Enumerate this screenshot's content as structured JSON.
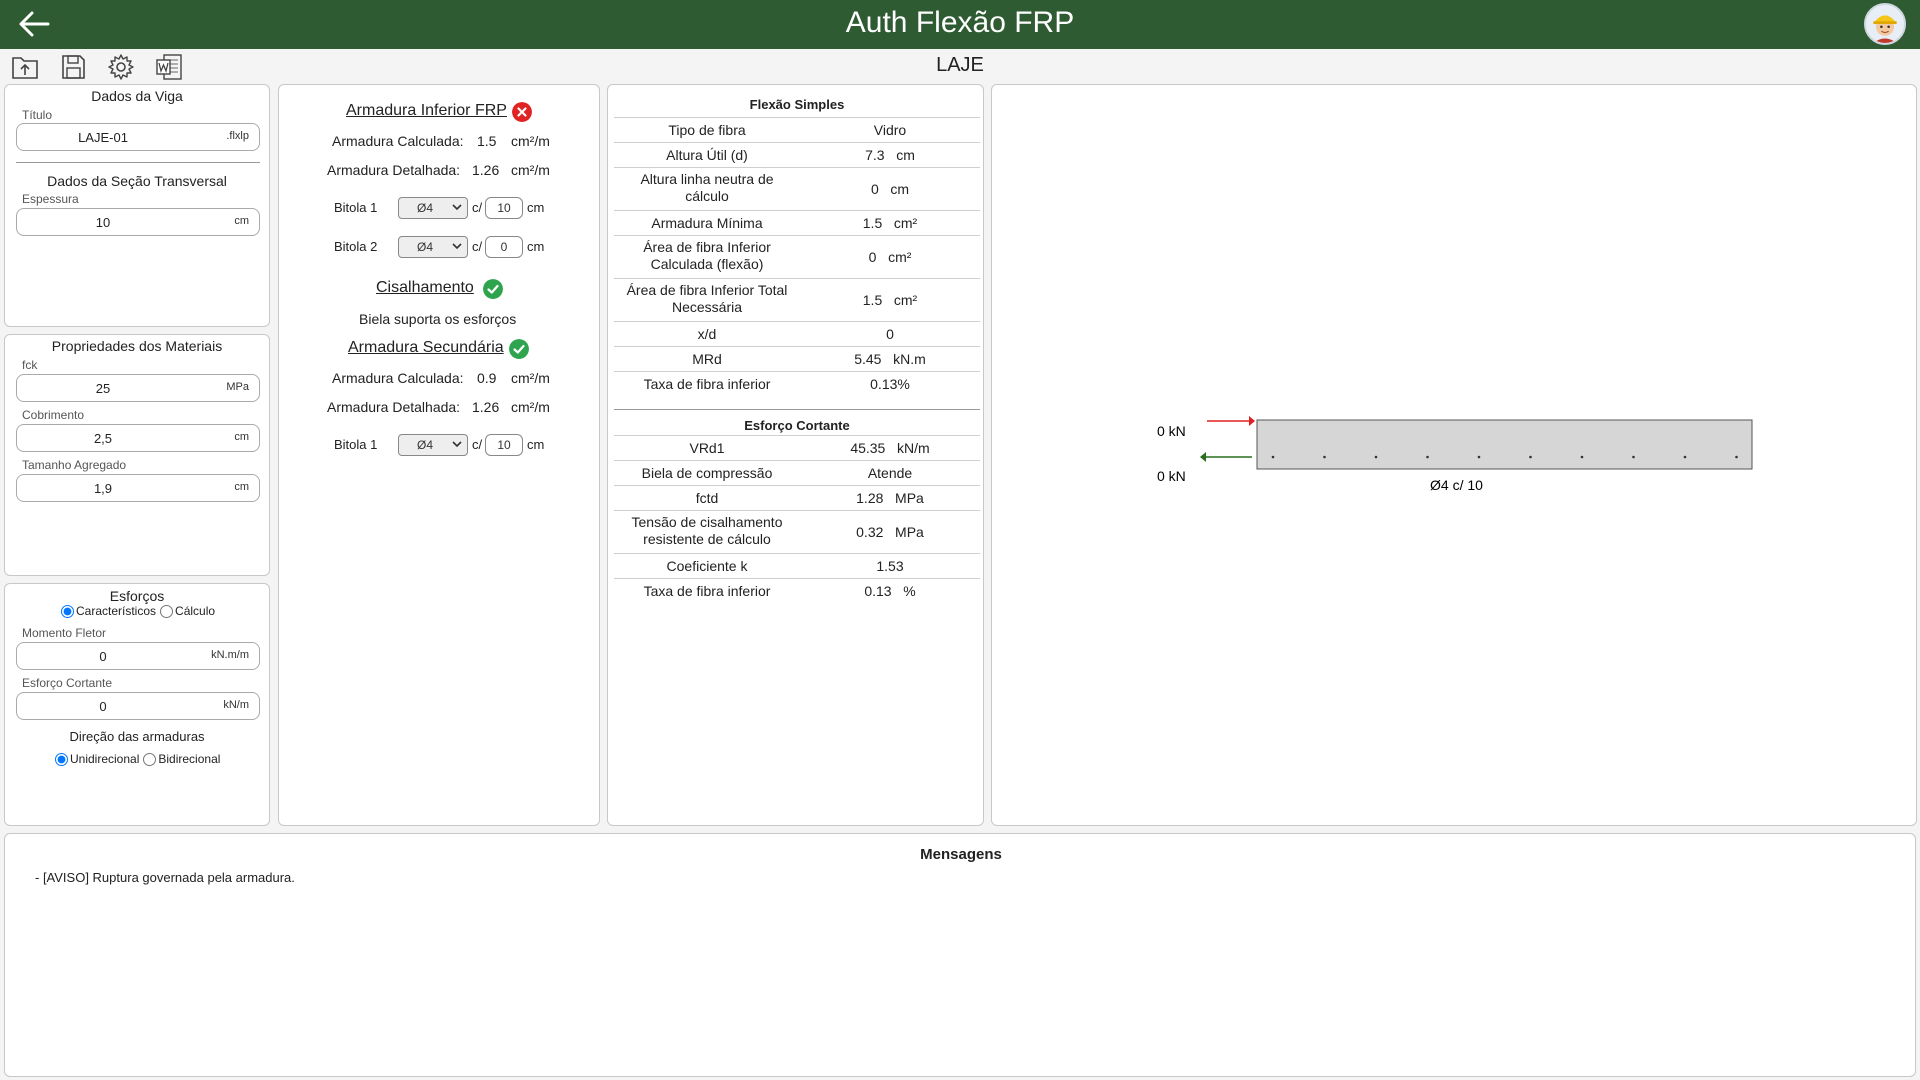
{
  "app": {
    "title": "Auth Flexão FRP",
    "page_title": "LAJE"
  },
  "toolbar": {
    "icons": [
      "upload-icon",
      "save-icon",
      "gear-icon",
      "word-export-icon"
    ]
  },
  "beam_data": {
    "title": "Dados da Viga",
    "titulo_label": "Título",
    "titulo_value": "LAJE-01",
    "titulo_unit": ".flxlp",
    "section_title": "Dados da Seção Transversal",
    "espessura_label": "Espessura",
    "espessura_value": "10",
    "espessura_unit": "cm"
  },
  "materials": {
    "title": "Propriedades dos Materiais",
    "fck_label": "fck",
    "fck_value": "25",
    "fck_unit": "MPa",
    "cobrimento_label": "Cobrimento",
    "cobrimento_value": "2,5",
    "cobrimento_unit": "cm",
    "agregado_label": "Tamanho Agregado",
    "agregado_value": "1,9",
    "agregado_unit": "cm"
  },
  "efforts": {
    "title": "Esforços",
    "opt_caracteristicos": "Característicos",
    "opt_calculo": "Cálculo",
    "momento_label": "Momento Fletor",
    "momento_value": "0",
    "momento_unit": "kN.m/m",
    "cortante_label": "Esforço Cortante",
    "cortante_value": "0",
    "cortante_unit": "kN/m",
    "direcao_title": "Direção das armaduras",
    "opt_unidirecional": "Unidirecional",
    "opt_bidirecional": "Bidirecional"
  },
  "reinforcement": {
    "inferior_title": "Armadura Inferior FRP",
    "calc_label": "Armadura Calculada:",
    "inf_calc_value": "1.5",
    "det_label": "Armadura Detalhada:",
    "inf_det_value": "1.26",
    "unit": "cm²/m",
    "bitola1_label": "Bitola 1",
    "bitola2_label": "Bitola 2",
    "bitola_option": "Ø4",
    "spacing_sep": "c/",
    "spacing_unit": "cm",
    "inf_b1_spacing": "10",
    "inf_b2_spacing": "0",
    "cis_title": "Cisalhamento",
    "cis_text": "Biela suporta os esforços",
    "sec_title": "Armadura Secundária",
    "sec_calc_value": "0.9",
    "sec_det_value": "1.26",
    "sec_b1_spacing": "10"
  },
  "results": {
    "flexao_title": "Flexão Simples",
    "flexao_rows": [
      {
        "label": "Tipo de fibra",
        "value": "Vidro"
      },
      {
        "label": "Altura Útil (d)",
        "value": "7.3   cm"
      },
      {
        "label": "Altura linha neutra de cálculo",
        "value": "0   cm"
      },
      {
        "label": "Armadura Mínima",
        "value": "1.5   cm²"
      },
      {
        "label": "Área de fibra Inferior Calculada (flexão)",
        "value": "0   cm²"
      },
      {
        "label": "Área de fibra Inferior Total Necessária",
        "value": "1.5   cm²"
      },
      {
        "label": "x/d",
        "value": "0"
      },
      {
        "label": "MRd",
        "value": "5.45   kN.m"
      },
      {
        "label": "Taxa de fibra inferior",
        "value": "0.13%"
      }
    ],
    "cortante_title": "Esforço Cortante",
    "cortante_rows": [
      {
        "label": "VRd1",
        "value": "45.35   kN/m"
      },
      {
        "label": "Biela de compressão",
        "value": "Atende"
      },
      {
        "label": "fctd",
        "value": "1.28   MPa"
      },
      {
        "label": "Tensão de cisalhamento resistente de cálculo",
        "value": "0.32   MPa"
      },
      {
        "label": "Coeficiente k",
        "value": "1.53"
      },
      {
        "label": "Taxa de fibra inferior",
        "value": "0.13   %"
      }
    ]
  },
  "drawing": {
    "top_force": "0 kN",
    "bottom_force": "0 kN",
    "bar_label": "Ø4 c/ 10",
    "top_arrow_color": "#e02020",
    "bottom_arrow_color": "#2a6e1e"
  },
  "messages": {
    "title": "Mensagens",
    "lines": [
      "- [AVISO] Ruptura governada pela armadura."
    ]
  }
}
